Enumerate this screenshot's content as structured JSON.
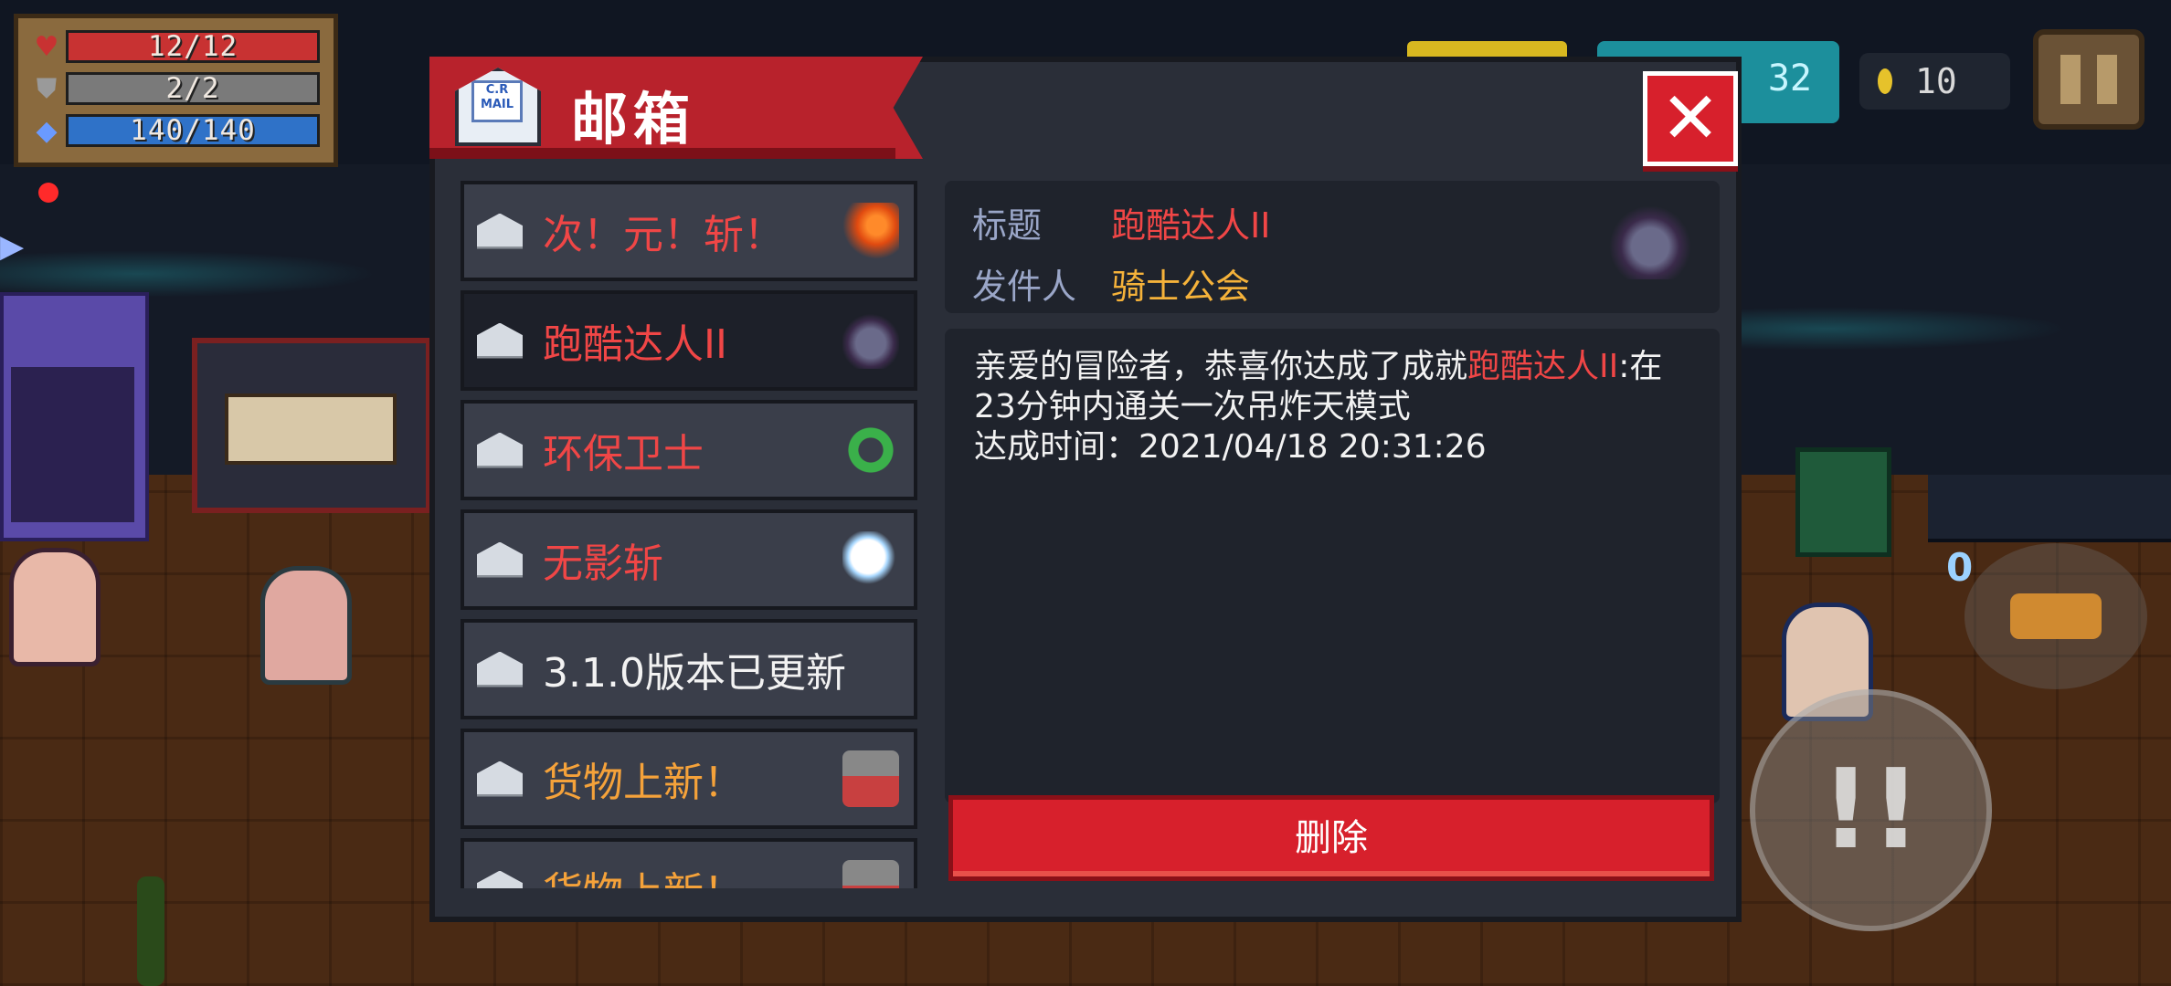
{
  "hud": {
    "hp": {
      "text": "12/12",
      "fraction": 1.0
    },
    "armor": {
      "text": "2/2",
      "fraction": 1.0
    },
    "energy": {
      "text": "140/140",
      "fraction": 1.0
    },
    "gems": "32",
    "coins": "10"
  },
  "mailbox": {
    "title": "邮箱",
    "envelope_text": "C.R MAIL",
    "close_label": "✕",
    "items": [
      {
        "label": "次！元！斩！",
        "color": "red",
        "thumb": "fire-blade-icon"
      },
      {
        "label": "跑酷达人II",
        "color": "red",
        "thumb": "shadow-monster-icon",
        "selected": true
      },
      {
        "label": "环保卫士",
        "color": "red",
        "thumb": "recycle-icon"
      },
      {
        "label": "无影斩",
        "color": "red",
        "thumb": "moon-blade-icon"
      },
      {
        "label": "3.1.0版本已更新",
        "color": "white",
        "thumb": ""
      },
      {
        "label": "货物上新！",
        "color": "orange",
        "thumb": "merchant-stall-icon"
      },
      {
        "label": "货物上新！",
        "color": "orange",
        "thumb": "merchant-stall-icon"
      }
    ],
    "detail": {
      "subject_key": "标题",
      "subject_value": "跑酷达人II",
      "sender_key": "发件人",
      "sender_value": "骑士公会",
      "body_line1_prefix": "亲爱的冒险者，恭喜你达成了成就",
      "body_line1_highlight": "跑酷达人II",
      "body_line1_suffix": ":在",
      "body_line2": "23分钟内通关一次吊炸天模式",
      "body_line3": "达成时间：2021/04/18 20:31:26"
    },
    "delete_label": "删除"
  },
  "colors": {
    "accent_red": "#d7202c",
    "highlight_red": "#f04646",
    "orange_text": "#f5a23a",
    "panel_bg": "#2a2e38"
  }
}
